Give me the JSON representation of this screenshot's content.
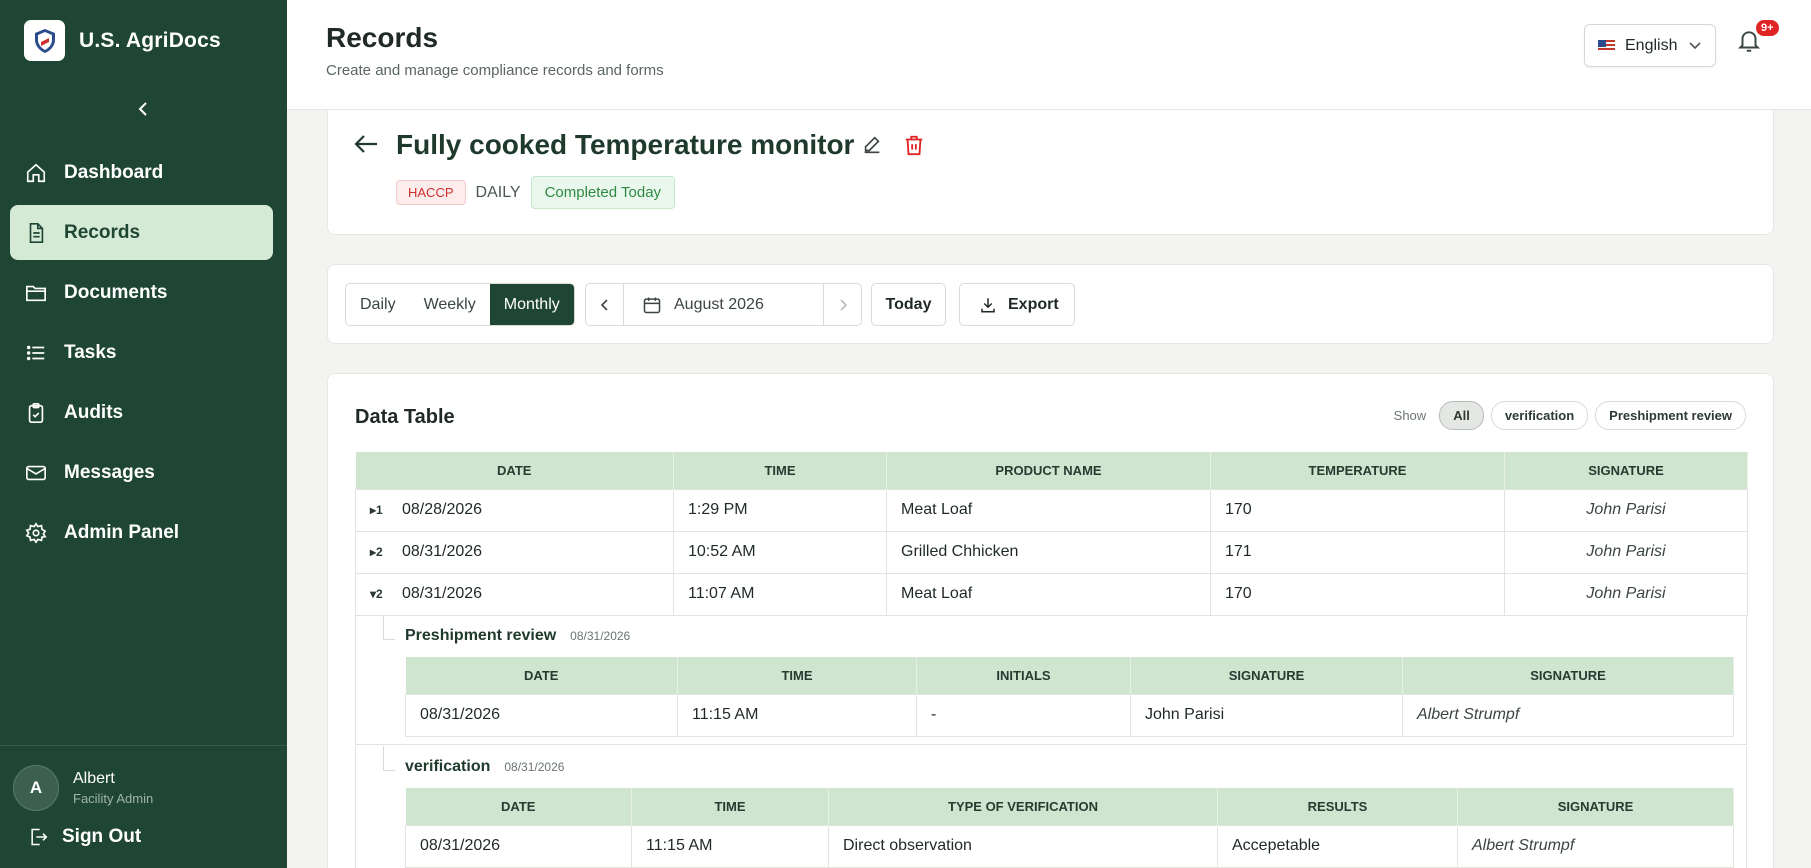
{
  "app": {
    "name": "U.S. AgriDocs"
  },
  "sidebar": {
    "collapse_label": "collapse",
    "items": [
      {
        "label": "Dashboard",
        "icon": "home-icon",
        "active": false
      },
      {
        "label": "Records",
        "icon": "document-icon",
        "active": true
      },
      {
        "label": "Documents",
        "icon": "folder-icon",
        "active": false
      },
      {
        "label": "Tasks",
        "icon": "list-icon",
        "active": false
      },
      {
        "label": "Audits",
        "icon": "clipboard-icon",
        "active": false
      },
      {
        "label": "Messages",
        "icon": "mail-icon",
        "active": false
      },
      {
        "label": "Admin Panel",
        "icon": "gear-icon",
        "active": false
      }
    ],
    "user": {
      "initial": "A",
      "name": "Albert",
      "role": "Facility Admin"
    },
    "signout_label": "Sign Out"
  },
  "header": {
    "title": "Records",
    "subtitle": "Create and manage compliance records and forms",
    "language": "English",
    "notification_count": "9+"
  },
  "form": {
    "title": "Fully cooked Temperature monitor",
    "tag_type": "HACCP",
    "frequency": "DAILY",
    "status": "Completed Today"
  },
  "toolbar": {
    "views": [
      "Daily",
      "Weekly",
      "Monthly"
    ],
    "active_view": "Monthly",
    "period": "August 2026",
    "today_label": "Today",
    "export_label": "Export"
  },
  "data_table": {
    "title": "Data Table",
    "show_label": "Show",
    "filters": [
      "All",
      "verification",
      "Preshipment review"
    ],
    "active_filter": "All",
    "columns": [
      "DATE",
      "TIME",
      "PRODUCT NAME",
      "TEMPERATURE",
      "SIGNATURE"
    ],
    "rows": [
      {
        "marker": "▸1",
        "date": "08/28/2026",
        "time": "1:29 PM",
        "product": "Meat Loaf",
        "temperature": "170",
        "signature": "John Parisi"
      },
      {
        "marker": "▸2",
        "date": "08/31/2026",
        "time": "10:52 AM",
        "product": "Grilled Chhicken",
        "temperature": "171",
        "signature": "John Parisi"
      },
      {
        "marker": "▾2",
        "date": "08/31/2026",
        "time": "11:07 AM",
        "product": "Meat Loaf",
        "temperature": "170",
        "signature": "John Parisi"
      }
    ],
    "sub_records": [
      {
        "name": "Preshipment review",
        "date": "08/31/2026",
        "columns": [
          "DATE",
          "TIME",
          "INITIALS",
          "SIGNATURE",
          "SIGNATURE"
        ],
        "rows": [
          [
            "08/31/2026",
            "11:15 AM",
            "-",
            "John Parisi",
            "Albert Strumpf"
          ]
        ]
      },
      {
        "name": "verification",
        "date": "08/31/2026",
        "columns": [
          "DATE",
          "TIME",
          "TYPE OF VERIFICATION",
          "RESULTS",
          "SIGNATURE"
        ],
        "rows": [
          [
            "08/31/2026",
            "11:15 AM",
            "Direct observation",
            "Accepetable",
            "Albert Strumpf"
          ]
        ]
      }
    ]
  },
  "colors": {
    "sidebar": "#1f4634",
    "accent_light": "#d5ead5",
    "table_header": "#cfe5cf",
    "danger": "#e02424"
  }
}
